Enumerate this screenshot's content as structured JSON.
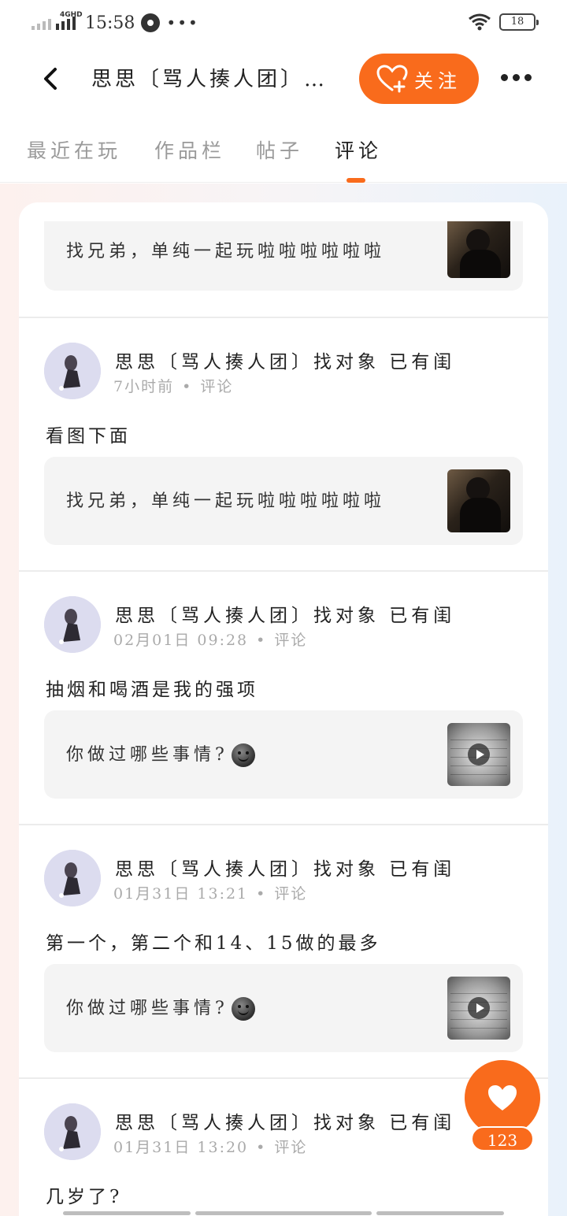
{
  "status_bar": {
    "network": "4GHD",
    "time": "15:58",
    "dots": "•••",
    "battery": "18"
  },
  "header": {
    "title": "思思〔骂人揍人团〕…",
    "follow_label": "关注"
  },
  "tabs": [
    {
      "label": "最近在玩",
      "active": false
    },
    {
      "label": "作品栏",
      "active": false
    },
    {
      "label": "帖子",
      "active": false
    },
    {
      "label": "评论",
      "active": true
    }
  ],
  "comments": [
    {
      "author": "",
      "meta_time": "",
      "meta_type": "",
      "text": "",
      "quote": {
        "text": "找兄弟，单纯一起玩啦啦啦啦啦啦",
        "thumb": "photo",
        "emoji": false
      }
    },
    {
      "author": "思思〔骂人揍人团〕找对象 已有闺",
      "meta_time": "7小时前",
      "meta_type": "评论",
      "text": "看图下面",
      "quote": {
        "text": "找兄弟，单纯一起玩啦啦啦啦啦啦",
        "thumb": "photo",
        "emoji": false
      }
    },
    {
      "author": "思思〔骂人揍人团〕找对象 已有闺",
      "meta_time": "02月01日 09:28",
      "meta_type": "评论",
      "text": "抽烟和喝酒是我的强项",
      "quote": {
        "text": "你做过哪些事情?",
        "thumb": "video",
        "emoji": true
      }
    },
    {
      "author": "思思〔骂人揍人团〕找对象 已有闺",
      "meta_time": "01月31日 13:21",
      "meta_type": "评论",
      "text": "第一个，第二个和14、15做的最多",
      "quote": {
        "text": "你做过哪些事情?",
        "thumb": "video",
        "emoji": true
      }
    },
    {
      "author": "思思〔骂人揍人团〕找对象 已有闺",
      "meta_time": "01月31日 13:20",
      "meta_type": "评论",
      "text": "几岁了?",
      "quote": null
    }
  ],
  "like_fab": {
    "count": "123"
  },
  "colors": {
    "accent": "#f96b1c",
    "card_bg": "#f4f4f4",
    "muted_text": "#aaaaaa"
  }
}
